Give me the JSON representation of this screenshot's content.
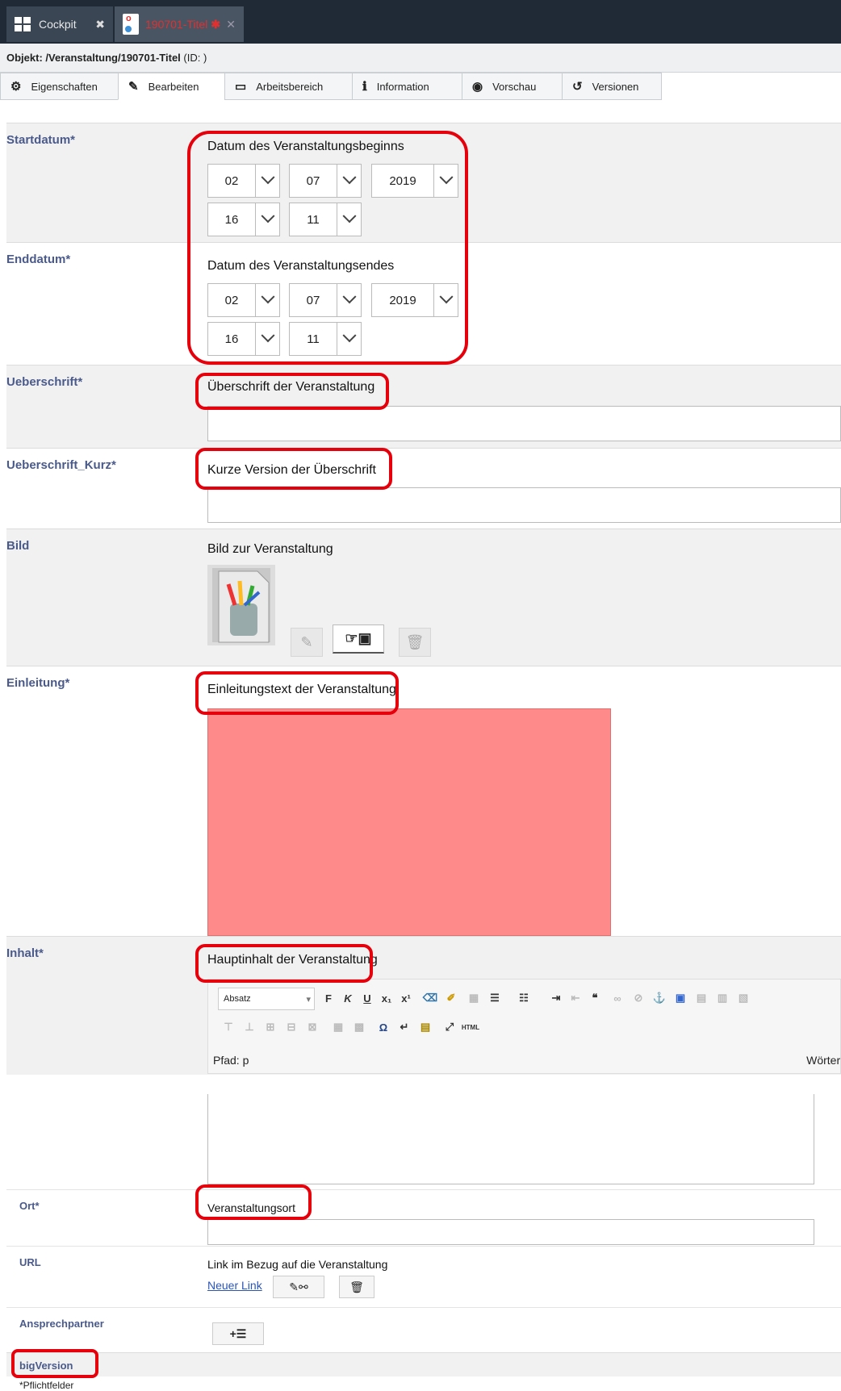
{
  "tabs": [
    {
      "label": "Cockpit",
      "close": "✖"
    },
    {
      "label": "190701-Titel",
      "star": "✱",
      "close": "✕"
    }
  ],
  "object_line": {
    "prefix": "Objekt: /Veranstaltung/190701-Titel",
    "suffix": "(ID: )"
  },
  "toolbar": [
    {
      "icon": "⚙",
      "label": "Eigenschaften"
    },
    {
      "icon": "✎",
      "label": "Bearbeiten"
    },
    {
      "icon": "▭",
      "label": "Arbeitsbereich"
    },
    {
      "icon": "ℹ",
      "label": "Information"
    },
    {
      "icon": "◉",
      "label": "Vorschau"
    },
    {
      "icon": "↺",
      "label": "Versionen"
    }
  ],
  "fields": {
    "startdatum": {
      "label": "Startdatum*",
      "desc": "Datum des Veranstaltungsbeginns",
      "day": "02",
      "month": "07",
      "year": "2019",
      "hour": "16",
      "minute": "11"
    },
    "enddatum": {
      "label": "Enddatum*",
      "desc": "Datum des Veranstaltungsendes",
      "day": "02",
      "month": "07",
      "year": "2019",
      "hour": "16",
      "minute": "11"
    },
    "ueberschrift": {
      "label": "Ueberschrift*",
      "desc": "Überschrift der Veranstaltung",
      "value": ""
    },
    "ueberschrift_kurz": {
      "label": "Ueberschrift_Kurz*",
      "desc": "Kurze Version der Überschrift",
      "value": ""
    },
    "bild": {
      "label": "Bild",
      "desc": "Bild zur Veranstaltung"
    },
    "einleitung": {
      "label": "Einleitung*",
      "desc": "Einleitungstext der Veranstaltung",
      "value": ""
    },
    "inhalt": {
      "label": "Inhalt*",
      "desc": "Hauptinhalt der Veranstaltung",
      "format_select": "Absatz",
      "path": "Pfad: p",
      "words": "Wörter:"
    },
    "ort": {
      "label": "Ort*",
      "desc": "Veranstaltungsort",
      "value": ""
    },
    "url": {
      "label": "URL",
      "desc": "Link im Bezug auf die Veranstaltung",
      "new_link": "Neuer Link"
    },
    "ansprechpartner": {
      "label": "Ansprechpartner"
    },
    "bigversion": {
      "label": "bigVersion"
    }
  },
  "footer_note": "*Pflichtfelder",
  "colors": {
    "highlight_red": "#e5000b",
    "textarea_pink": "#ff8a8a",
    "label_blue": "#4a5a8a",
    "topbar": "#1f2a36"
  }
}
